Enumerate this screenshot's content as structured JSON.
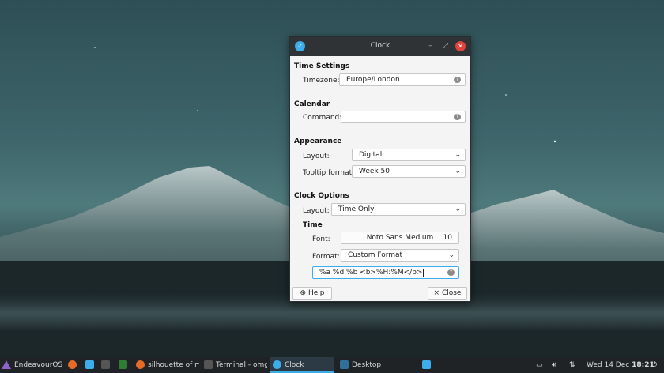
{
  "window": {
    "title": "Clock",
    "sections": {
      "time_settings": "Time Settings",
      "calendar": "Calendar",
      "appearance": "Appearance",
      "clock_options": "Clock Options",
      "time": "Time"
    },
    "timezone": {
      "label": "Timezone:",
      "value": "Europe/London"
    },
    "command": {
      "label": "Command:",
      "value": ""
    },
    "appearance_layout": {
      "label": "Layout:",
      "value": "Digital"
    },
    "tooltip_format": {
      "label": "Tooltip format:",
      "value": "Week 50"
    },
    "clock_layout": {
      "label": "Layout:",
      "value": "Time Only"
    },
    "font": {
      "label": "Font:",
      "name": "Noto Sans Medium",
      "size": "10"
    },
    "format": {
      "label": "Format:",
      "value": "Custom Format"
    },
    "custom_format": {
      "value": "%a %d %b  <b>%H:%M</b>"
    },
    "help_label": "Help",
    "close_label": "Close"
  },
  "taskbar": {
    "start_label": "EndeavourOS",
    "tasks": [
      {
        "label": "silhouette of m..."
      },
      {
        "label": "Terminal - omg..."
      },
      {
        "label": "Clock"
      },
      {
        "label": "Desktop"
      }
    ],
    "clock": "Wed 14 Dec",
    "time": "18:21"
  },
  "colors": {
    "accent": "#3daee9",
    "close": "#e0443d",
    "panel": "#1f2326"
  }
}
